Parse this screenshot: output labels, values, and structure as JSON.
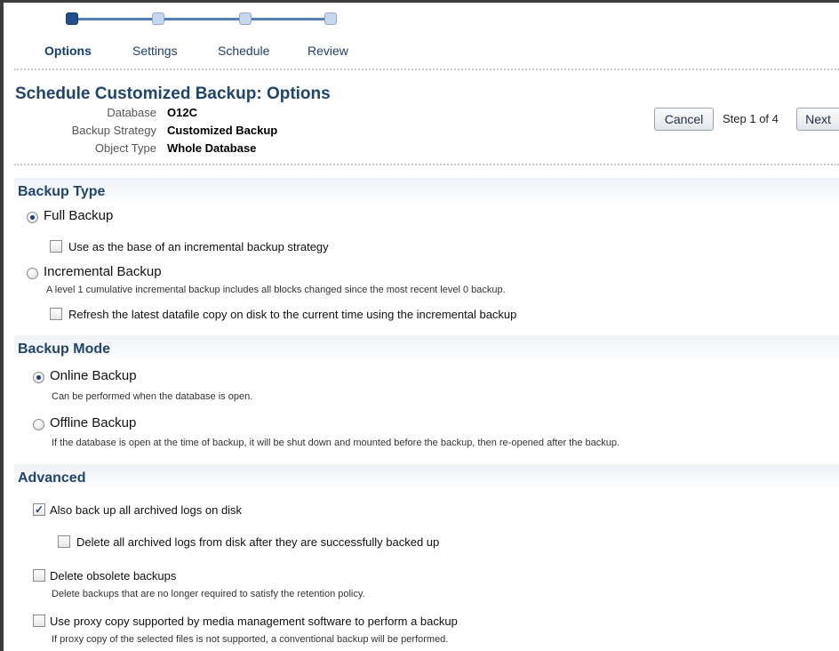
{
  "train": {
    "steps": [
      {
        "label": "Options",
        "active": true
      },
      {
        "label": "Settings",
        "active": false
      },
      {
        "label": "Schedule",
        "active": false
      },
      {
        "label": "Review",
        "active": false
      }
    ]
  },
  "header": {
    "title": "Schedule Customized Backup: Options",
    "info": [
      {
        "label": "Database",
        "value": "O12C"
      },
      {
        "label": "Backup Strategy",
        "value": "Customized Backup"
      },
      {
        "label": "Object Type",
        "value": "Whole Database"
      }
    ]
  },
  "actions": {
    "cancel_label": "Cancel",
    "step_text": "Step 1 of 4",
    "next_label": "Next"
  },
  "backup_type": {
    "heading": "Backup Type",
    "full_label": "Full Backup",
    "full_selected": true,
    "base_incremental_label": "Use as the base of an incremental backup strategy",
    "base_incremental_checked": false,
    "incremental_label": "Incremental Backup",
    "incremental_selected": false,
    "incremental_desc": "A level 1 cumulative incremental backup includes all blocks changed since the most recent level 0 backup.",
    "refresh_label": "Refresh the latest datafile copy on disk to the current time using the incremental backup",
    "refresh_checked": false
  },
  "backup_mode": {
    "heading": "Backup Mode",
    "online_label": "Online Backup",
    "online_selected": true,
    "online_desc": "Can be performed when the database is open.",
    "offline_label": "Offline Backup",
    "offline_selected": false,
    "offline_desc": "If the database is open at the time of backup, it will be shut down and mounted before the backup, then re-opened after the backup."
  },
  "advanced": {
    "heading": "Advanced",
    "archived_logs_label": "Also back up all archived logs on disk",
    "archived_logs_checked": true,
    "delete_archived_label": "Delete all archived logs from disk after they are successfully backed up",
    "delete_archived_checked": false,
    "delete_obsolete_label": "Delete obsolete backups",
    "delete_obsolete_checked": false,
    "delete_obsolete_desc": "Delete backups that are no longer required to satisfy the retention policy.",
    "proxy_label": "Use proxy copy supported by media management software to perform a backup",
    "proxy_checked": false,
    "proxy_desc": "If proxy copy of the selected files is not supported, a conventional backup will be performed."
  },
  "colors": {
    "heading": "#1f4470",
    "train_active": "#1f4f8f",
    "train_inactive": "#c7d7ee"
  }
}
